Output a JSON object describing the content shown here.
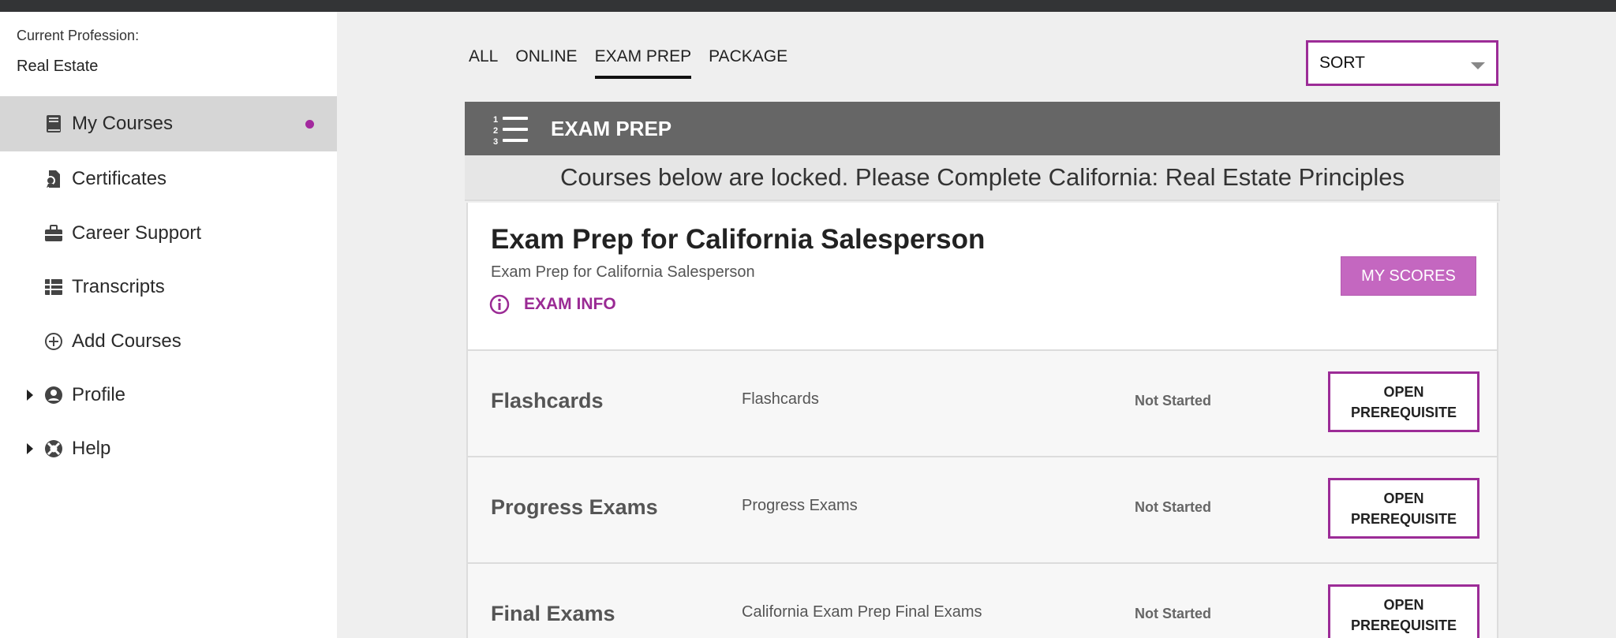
{
  "sidebar": {
    "profession_label": "Current Profession:",
    "profession_value": "Real Estate",
    "items": [
      {
        "label": "My Courses",
        "icon": "book-icon",
        "active": true
      },
      {
        "label": "Certificates",
        "icon": "certificate-icon"
      },
      {
        "label": "Career Support",
        "icon": "briefcase-icon"
      },
      {
        "label": "Transcripts",
        "icon": "transcripts-icon"
      },
      {
        "label": "Add Courses",
        "icon": "plus-circle-icon"
      },
      {
        "label": "Profile",
        "icon": "user-circle-icon",
        "expandable": true
      },
      {
        "label": "Help",
        "icon": "lifebuoy-icon",
        "expandable": true
      }
    ]
  },
  "tabs": [
    {
      "label": "ALL"
    },
    {
      "label": "ONLINE"
    },
    {
      "label": "EXAM PREP",
      "active": true
    },
    {
      "label": "PACKAGE"
    }
  ],
  "sort": {
    "label": "SORT"
  },
  "section": {
    "title": "EXAM PREP",
    "locked_message": "Courses below are locked. Please Complete California: Real Estate Principles"
  },
  "course": {
    "title": "Exam Prep for California Salesperson",
    "subtitle": "Exam Prep for California Salesperson",
    "info_label": "EXAM INFO",
    "scores_button": "MY SCORES"
  },
  "rows": [
    {
      "title": "Flashcards",
      "description": "Flashcards",
      "status": "Not Started",
      "button": "OPEN\nPREREQUISITE"
    },
    {
      "title": "Progress Exams",
      "description": "Progress Exams",
      "status": "Not Started",
      "button": "OPEN\nPREREQUISITE"
    },
    {
      "title": "Final Exams",
      "description": "California Exam Prep Final Exams",
      "status": "Not Started",
      "button": "OPEN\nPREREQUISITE"
    }
  ],
  "colors": {
    "accent": "#9c2c97",
    "header_bg": "#666666",
    "scores_bg": "#c467c0"
  }
}
